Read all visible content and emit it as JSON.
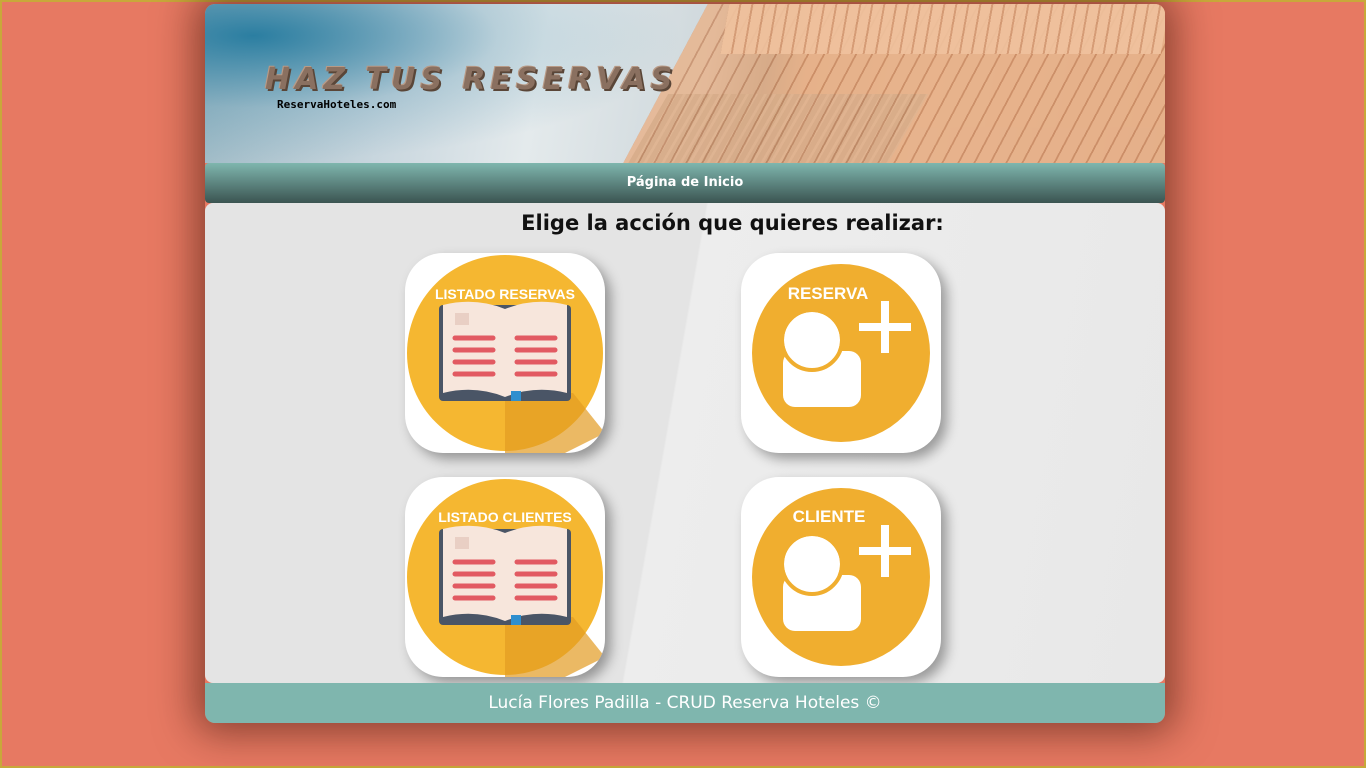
{
  "banner": {
    "title": "HAZ TUS RESERVAS",
    "subtitle": "ReservaHoteles.com"
  },
  "nav": {
    "home_label": "Página de Inicio"
  },
  "main": {
    "heading": "Elige la acción que quieres realizar:",
    "tiles": [
      {
        "label": "LISTADO RESERVAS",
        "icon": "open-book-icon"
      },
      {
        "label": "RESERVA",
        "icon": "add-user-icon"
      },
      {
        "label": "LISTADO CLIENTES",
        "icon": "open-book-icon"
      },
      {
        "label": "CLIENTE",
        "icon": "add-user-icon"
      }
    ]
  },
  "footer": {
    "text": "Lucía Flores Padilla - CRUD Reserva Hoteles ©"
  },
  "colors": {
    "background": "#e77962",
    "nav_teal": "#7fb6ae",
    "icon_yellow": "#f5b731",
    "book_red": "#e25a62"
  }
}
